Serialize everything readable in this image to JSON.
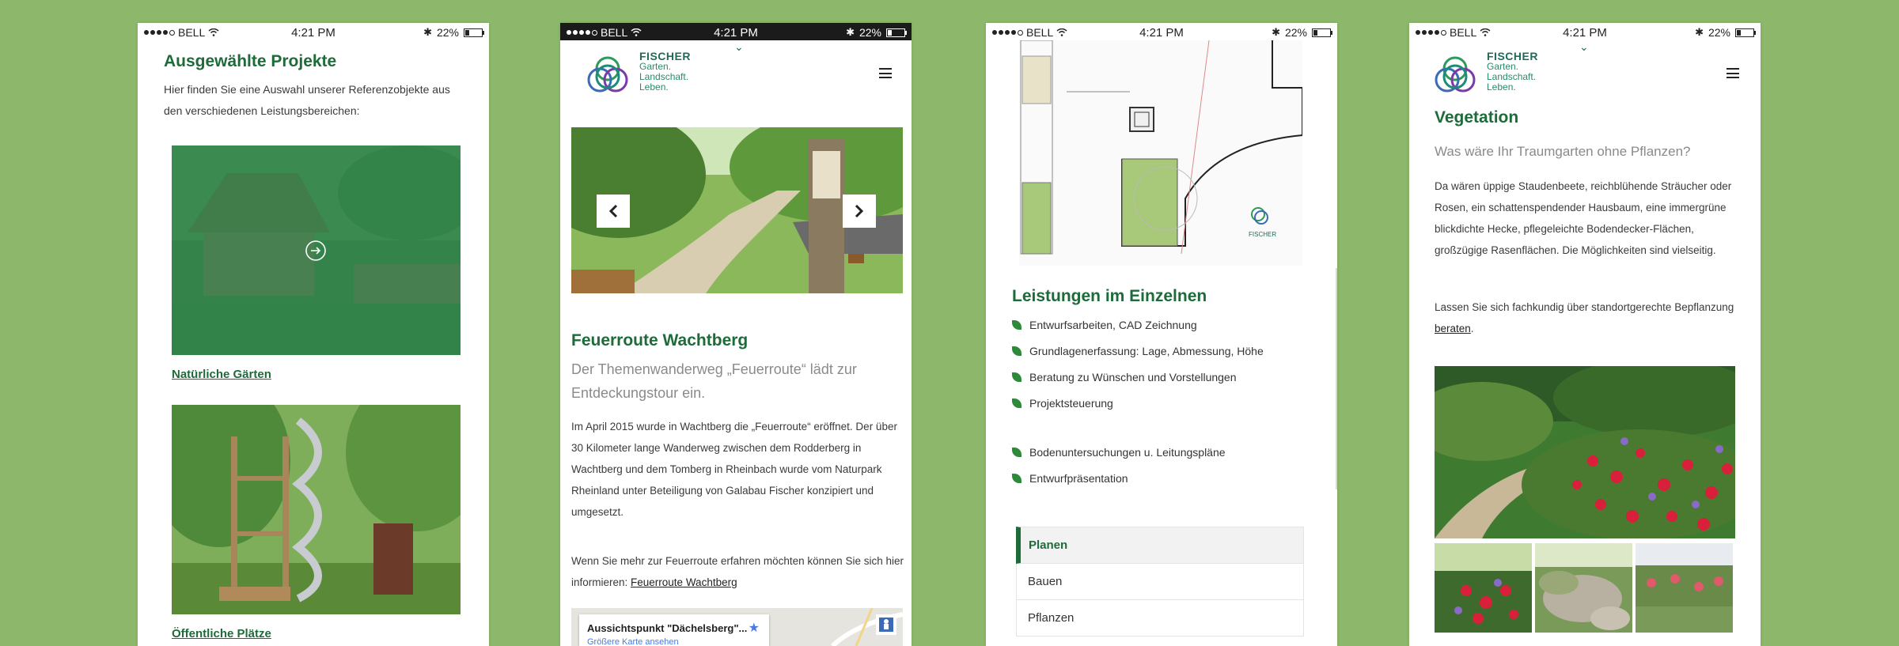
{
  "status_bar": {
    "carrier": "BELL",
    "time": "4:21 PM",
    "battery": "22%"
  },
  "logo": {
    "brand": "FISCHER",
    "line1": "Garten.",
    "line2": "Landschaft.",
    "line3": "Leben."
  },
  "screen1": {
    "title": "Ausgewählte Projekte",
    "intro": "Hier finden Sie eine Auswahl unserer Referenzobjekte aus den verschiedenen Leistungsbereichen:",
    "project1_label": "Natürliche Gärten",
    "project2_label": "Öffentliche Plätze"
  },
  "screen2": {
    "title": "Feuerroute Wachtberg",
    "subtitle": "Der Themenwanderweg „Feuerroute“ lädt zur Entdeckungstour ein.",
    "para1": "Im April 2015 wurde in Wachtberg die „Feuerroute“ eröffnet. Der über 30 Kilometer lange Wanderweg zwischen dem Rodderberg in Wachtberg und dem Tomberg in Rheinbach wurde vom Naturpark Rheinland unter Beteiligung von Galabau Fischer konzipiert und umgesetzt.",
    "para2_prefix": "Wenn Sie mehr zur Feuerroute erfahren möchten können Sie sich hier informieren: ",
    "para2_link": "Feuerroute Wachtberg",
    "map_place": "Aussichtspunkt \"Dächelsberg\"...",
    "map_link": "Größere Karte ansehen"
  },
  "screen3": {
    "title": "Leistungen im Einzelnen",
    "services_a": [
      "Entwurfsarbeiten, CAD Zeichnung",
      "Grundlagenerfassung: Lage, Abmessung, Höhe",
      "Beratung zu Wünschen und Vorstellungen",
      "Projektsteuerung"
    ],
    "services_b": [
      "Bodenuntersuchungen u. Leitungspläne",
      "Entwurfpräsentation"
    ],
    "accordion": [
      "Planen",
      "Bauen",
      "Pflanzen"
    ]
  },
  "screen4": {
    "title": "Vegetation",
    "subtitle": "Was wäre Ihr Traumgarten ohne Pflanzen?",
    "para1": "Da wären üppige Staudenbeete, reichblühende Sträucher oder Rosen, ein schattenspendender Hausbaum, eine immergrüne blickdichte Hecke, pflegeleichte Bodendecker-Flächen, großzügige Rasenflächen. Die Möglichkeiten sind vielseitig.",
    "para2_prefix": "Lassen Sie sich fachkundig über standortgerechte Bepflanzung ",
    "para2_link": "beraten",
    "para2_suffix": "."
  },
  "colors": {
    "background": "#8db86b",
    "brand_green": "#1e6b3a",
    "leaf_green": "#2e8a3a"
  },
  "icons": [
    "wifi-icon",
    "bluetooth-icon",
    "battery-icon",
    "arrow-circle-right-icon",
    "chevron-left-icon",
    "chevron-right-icon",
    "hamburger-menu-icon",
    "chevron-down-icon",
    "leaf-bullet-icon",
    "star-icon",
    "pegman-icon",
    "logo-icon"
  ]
}
